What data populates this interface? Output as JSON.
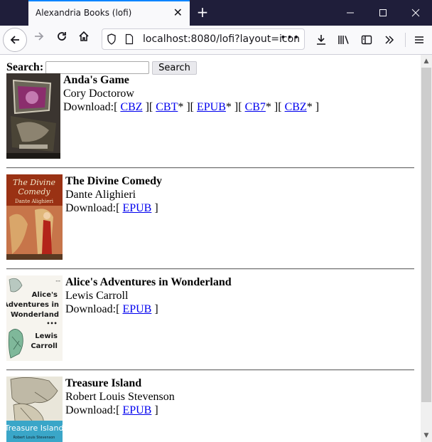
{
  "browser": {
    "tab_title": "Alexandria Books (lofi)",
    "url": "localhost:8080/lofi?layout=icon",
    "tab_close": "✕",
    "new_tab": "+",
    "more": "•••"
  },
  "search": {
    "label": "Search:",
    "value": "",
    "button": "Search"
  },
  "books": [
    {
      "title": "Anda's Game",
      "author": "Cory Doctorow",
      "download_label": "Download:",
      "formats": [
        {
          "label": "CBZ",
          "star": ""
        },
        {
          "label": "CBT",
          "star": "*"
        },
        {
          "label": "EPUB",
          "star": "*"
        },
        {
          "label": "CB7",
          "star": "*"
        },
        {
          "label": "CBZ",
          "star": "*"
        }
      ],
      "cover": {
        "top_text": "",
        "main_text": "",
        "bottom_text": ""
      }
    },
    {
      "title": "The Divine Comedy",
      "author": "Dante Alighieri",
      "download_label": "Download:",
      "formats": [
        {
          "label": "EPUB",
          "star": ""
        }
      ],
      "cover": {
        "top_text": "The Divine Comedy",
        "main_text": "",
        "bottom_text": "Dante Alighieri"
      }
    },
    {
      "title": "Alice's Adventures in Wonderland",
      "author": "Lewis Carroll",
      "download_label": "Download:",
      "formats": [
        {
          "label": "EPUB",
          "star": ""
        }
      ],
      "cover": {
        "top_text": "Alice's Adventures in Wonderland",
        "main_text": "Lewis Carroll",
        "bottom_text": ""
      }
    },
    {
      "title": "Treasure Island",
      "author": "Robert Louis Stevenson",
      "download_label": "Download:",
      "formats": [
        {
          "label": "EPUB",
          "star": ""
        }
      ],
      "cover": {
        "top_text": "",
        "main_text": "Treasure Island",
        "bottom_text": "Robert Louis Stevenson"
      }
    }
  ]
}
